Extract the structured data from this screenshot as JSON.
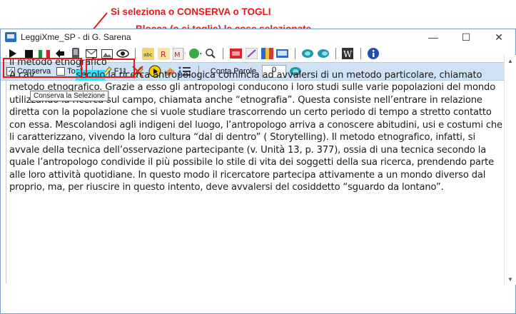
{
  "annotations": {
    "top_note": "Si seleziona o CONSERVA o TOGLI",
    "second_note": "Blocca (o si toglie) le cose selezionate",
    "color": "#e8181a"
  },
  "window": {
    "title": "LeggiXme_SP - di G. Sarena",
    "minimize": "—",
    "maximize": "☐",
    "close": "✕"
  },
  "toolbar2": {
    "conserva_label": "Conserva",
    "conserva_checked": true,
    "togli_label": "Togli",
    "togli_checked": false,
    "f11_label": "F11",
    "count_label": "Conta Parole",
    "count_value": "0"
  },
  "tooltip": "Conserva la Selezione",
  "document": {
    "heading": "Il metodo etnografico",
    "lead": "A cav",
    "highlighted": "secolo",
    "line1_rest": " la ricerca antropologica comincia ad avvalersi di un metodo particolare, chiamato metodo",
    "body": "etnografico. Grazie a esso gli antropologi conducono i loro studi sulle varie popolazioni del mondo utilizzando la ricerca sul campo, chiamata anche “etnografia”. Questa consiste nell’entrare in relazione diretta con la popolazione che si vuole studiare trascorrendo un certo periodo di tempo a stretto contatto con essa. Mescolandosi agli indigeni del luogo, l’antropologo arriva a conoscere abitudini, usi e costumi che li caratterizzano, vivendo la loro cultura “dal di dentro” ( Storytelling). Il metodo etnografico, infatti, si avvale della tecnica dell’osservazione partecipante (v. Unità 13, p. 377), ossia di una tecnica secondo la quale l’antropologo condivide il più possibile lo stile di vita dei soggetti della sua ricerca, prendendo parte alle loro attività quotidiane. In questo modo il ricercatore partecipa attivamente a un mondo diverso dal proprio, ma, per riuscire in questo intento, deve avvalersi del cosiddetto “sguardo da lontano”."
  }
}
